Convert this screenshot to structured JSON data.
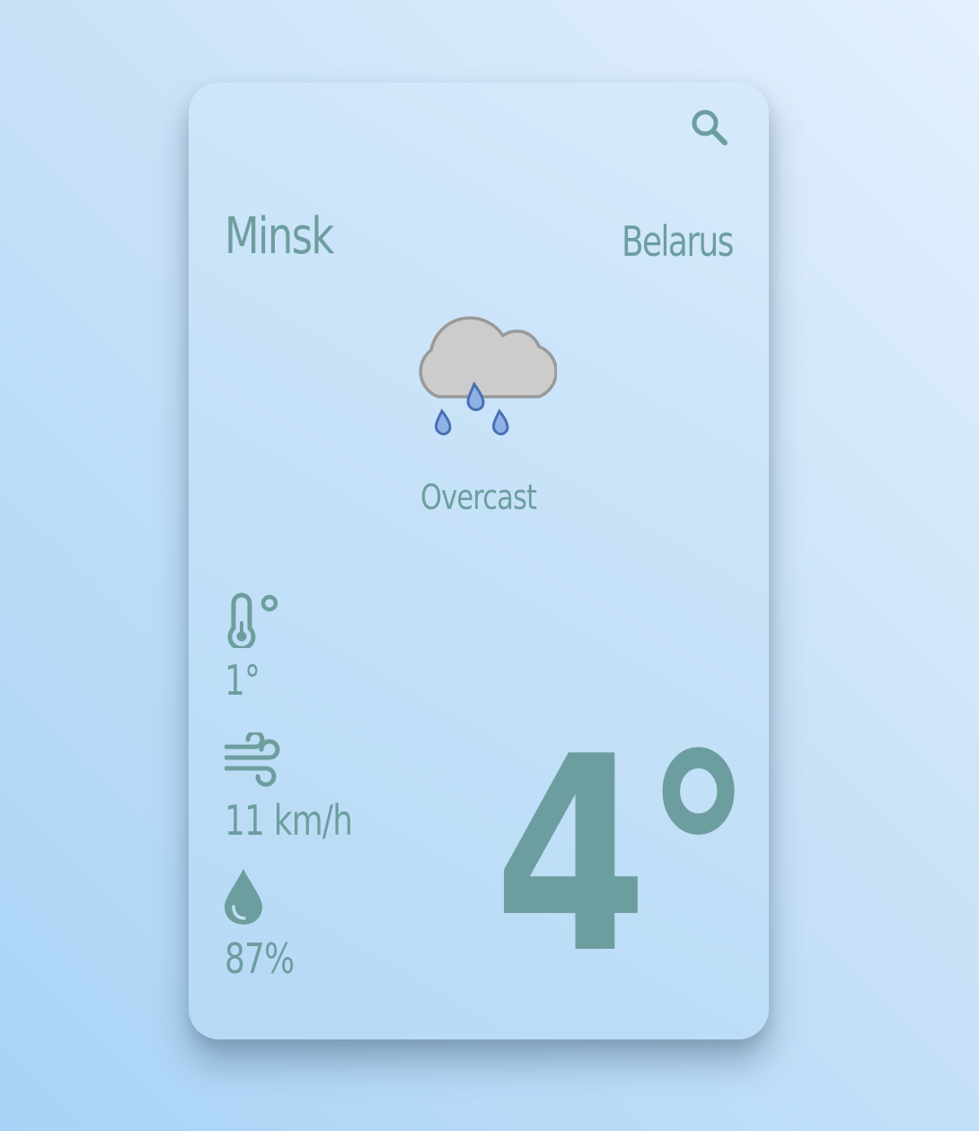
{
  "location": {
    "city": "Minsk",
    "country": "Belarus"
  },
  "current": {
    "condition": "Overcast",
    "condition_icon": "cloud-rain-icon",
    "temperature": "4°"
  },
  "stats": {
    "feels_like": {
      "icon": "thermometer-degree-icon",
      "value": "1°"
    },
    "wind": {
      "icon": "wind-icon",
      "value": "11 km/h"
    },
    "humidity": {
      "icon": "droplet-icon",
      "value": "87%"
    }
  },
  "search": {
    "icon": "search-icon"
  },
  "colors": {
    "accent": "#6d9e9f",
    "cloud_fill": "#cccccc",
    "cloud_stroke": "#999999",
    "drop_fill": "#8fb2e6",
    "drop_stroke": "#4a6fb3"
  }
}
